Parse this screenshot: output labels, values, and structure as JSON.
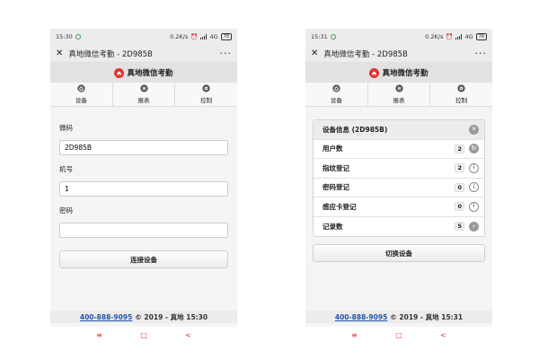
{
  "status_left": {
    "time": "15:30"
  },
  "status_right_phone": {
    "time": "15:31"
  },
  "status": {
    "speed": "0.2K/s",
    "network": "4G",
    "battery": "78"
  },
  "window": {
    "title": "真地微信考勤 - 2D985B"
  },
  "brand": {
    "name": "真地微信考勤"
  },
  "nav": {
    "items": [
      {
        "label": "设备",
        "icon": "device-icon"
      },
      {
        "label": "报表",
        "icon": "report-icon"
      },
      {
        "label": "控制",
        "icon": "control-icon"
      }
    ]
  },
  "form": {
    "code_label": "微码",
    "code_value": "2D985B",
    "machine_label": "机号",
    "machine_value": "1",
    "password_label": "密码",
    "password_value": "",
    "connect_button": "连接设备"
  },
  "device_info": {
    "header": "设备信息 (2D985B)",
    "rows": [
      {
        "label": "用户数",
        "count": "2"
      },
      {
        "label": "指纹登记",
        "count": "2"
      },
      {
        "label": "密码登记",
        "count": "0"
      },
      {
        "label": "感应卡登记",
        "count": "0"
      },
      {
        "label": "记录数",
        "count": "5"
      }
    ],
    "switch_button": "切换设备"
  },
  "footer": {
    "phone": "400-888-9095",
    "left_text": "© 2019 - 真地 15:30",
    "right_text": "© 2019 - 真地 15:31"
  },
  "sysnav": {
    "menu": "≡",
    "home": "□",
    "back": "<"
  },
  "colors": {
    "accent": "#e5322d",
    "link": "#2255aa"
  }
}
